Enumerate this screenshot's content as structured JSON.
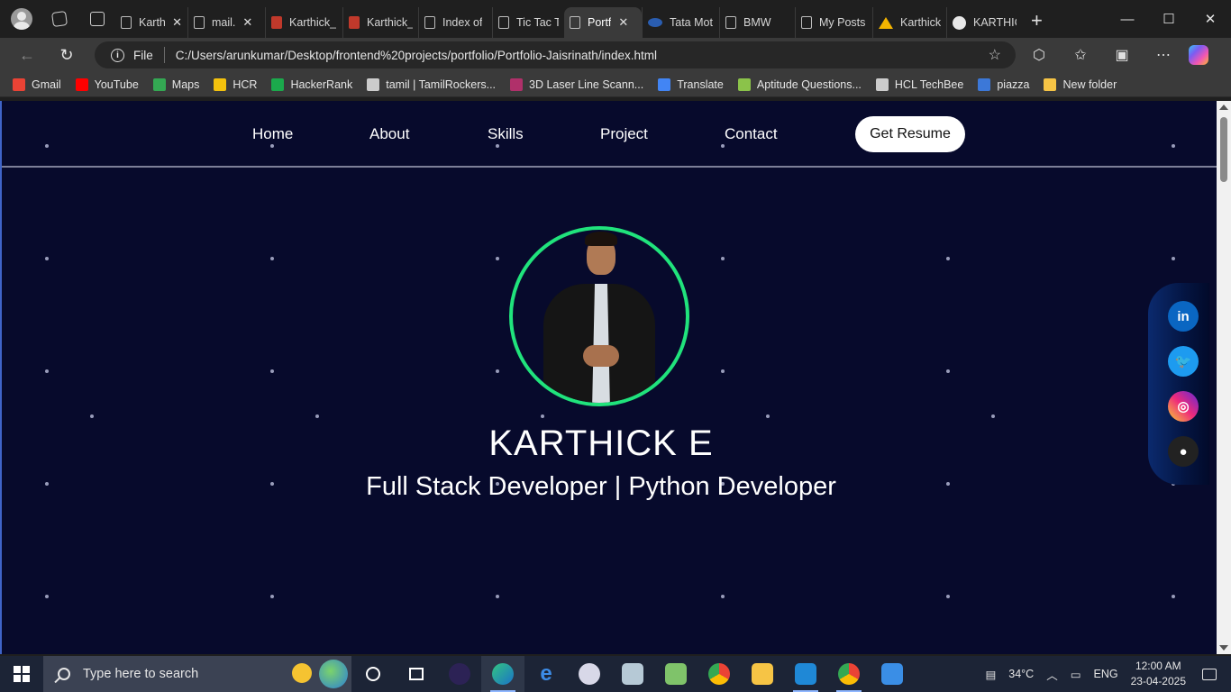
{
  "browser": {
    "tabs": [
      {
        "title": "Karth",
        "icon": "page-icon",
        "closable": true
      },
      {
        "title": "mail.",
        "icon": "page-icon",
        "closable": true
      },
      {
        "title": "Karthick_",
        "icon": "pdf-icon",
        "closable": false
      },
      {
        "title": "Karthick_",
        "icon": "pdf-icon",
        "closable": false
      },
      {
        "title": "Index of",
        "icon": "page-icon",
        "closable": false
      },
      {
        "title": "Tic Tac To",
        "icon": "page-icon",
        "closable": false
      },
      {
        "title": "Portf",
        "icon": "page-icon",
        "closable": true,
        "active": true
      },
      {
        "title": "Tata Mot",
        "icon": "tata-icon",
        "closable": false
      },
      {
        "title": "BMW",
        "icon": "page-icon",
        "closable": false
      },
      {
        "title": "My Posts",
        "icon": "page-icon",
        "closable": false
      },
      {
        "title": "Karthick_",
        "icon": "drive-icon",
        "closable": false
      },
      {
        "title": "KARTHIC",
        "icon": "github-icon",
        "closable": false
      }
    ],
    "close_glyph": "✕",
    "new_tab_glyph": "+",
    "window_controls": {
      "minimize": "—",
      "maximize": "☐",
      "close": "✕"
    },
    "address": {
      "scheme_label": "File",
      "url": "C:/Users/arunkumar/Desktop/frontend%20projects/portfolio/Portfolio-Jaisrinath/index.html"
    },
    "bookmarks": [
      {
        "label": "Gmail",
        "color": "#ea4335"
      },
      {
        "label": "YouTube",
        "color": "#ff0000"
      },
      {
        "label": "Maps",
        "color": "#34a853"
      },
      {
        "label": "HCR",
        "color": "#f4c20d"
      },
      {
        "label": "HackerRank",
        "color": "#1ba94c"
      },
      {
        "label": "tamil | TamilRockers...",
        "color": "#cccccc"
      },
      {
        "label": "3D Laser Line Scann...",
        "color": "#b0306a"
      },
      {
        "label": "Translate",
        "color": "#4285f4"
      },
      {
        "label": "Aptitude Questions...",
        "color": "#8bc34a"
      },
      {
        "label": "HCL TechBee",
        "color": "#cccccc"
      },
      {
        "label": "piazza",
        "color": "#3c78d8"
      },
      {
        "label": "New folder",
        "color": "#f6c445"
      }
    ]
  },
  "site": {
    "nav": [
      "Home",
      "About",
      "Skills",
      "Project",
      "Contact"
    ],
    "resume_button": "Get Resume",
    "name": "KARTHICK E",
    "role": "Full Stack Developer | Python Developer",
    "social": [
      {
        "label": "in",
        "icon": "linkedin-icon"
      },
      {
        "label": "🐦",
        "icon": "twitter-icon"
      },
      {
        "label": "◎",
        "icon": "instagram-icon"
      },
      {
        "label": "●",
        "icon": "github-icon"
      }
    ],
    "accent_color": "#20e37c",
    "background_color": "#070a2c"
  },
  "taskbar": {
    "search_placeholder": "Type here to search",
    "temperature": "34°C",
    "language": "ENG",
    "time": "12:00 AM",
    "date": "23-04-2025"
  }
}
